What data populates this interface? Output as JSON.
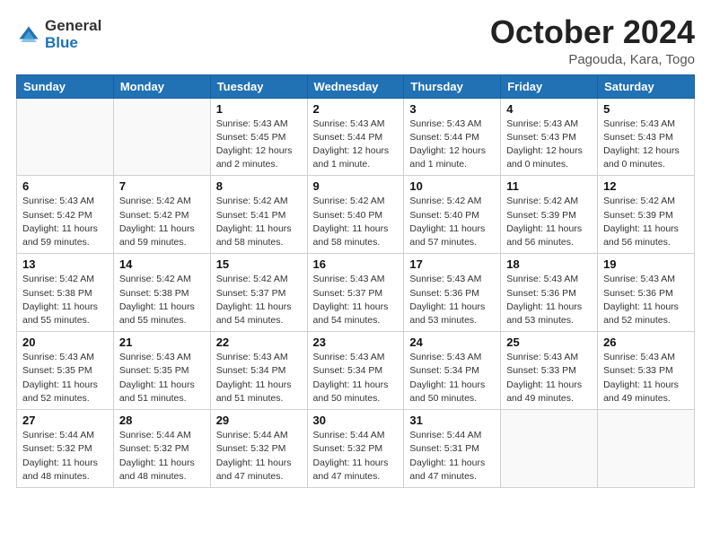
{
  "header": {
    "logo": {
      "general": "General",
      "blue": "Blue"
    },
    "title": "October 2024",
    "subtitle": "Pagouda, Kara, Togo"
  },
  "days": [
    "Sunday",
    "Monday",
    "Tuesday",
    "Wednesday",
    "Thursday",
    "Friday",
    "Saturday"
  ],
  "weeks": [
    [
      {
        "day": "",
        "info": ""
      },
      {
        "day": "",
        "info": ""
      },
      {
        "day": "1",
        "info": "Sunrise: 5:43 AM\nSunset: 5:45 PM\nDaylight: 12 hours and 2 minutes."
      },
      {
        "day": "2",
        "info": "Sunrise: 5:43 AM\nSunset: 5:44 PM\nDaylight: 12 hours and 1 minute."
      },
      {
        "day": "3",
        "info": "Sunrise: 5:43 AM\nSunset: 5:44 PM\nDaylight: 12 hours and 1 minute."
      },
      {
        "day": "4",
        "info": "Sunrise: 5:43 AM\nSunset: 5:43 PM\nDaylight: 12 hours and 0 minutes."
      },
      {
        "day": "5",
        "info": "Sunrise: 5:43 AM\nSunset: 5:43 PM\nDaylight: 12 hours and 0 minutes."
      }
    ],
    [
      {
        "day": "6",
        "info": "Sunrise: 5:43 AM\nSunset: 5:42 PM\nDaylight: 11 hours and 59 minutes."
      },
      {
        "day": "7",
        "info": "Sunrise: 5:42 AM\nSunset: 5:42 PM\nDaylight: 11 hours and 59 minutes."
      },
      {
        "day": "8",
        "info": "Sunrise: 5:42 AM\nSunset: 5:41 PM\nDaylight: 11 hours and 58 minutes."
      },
      {
        "day": "9",
        "info": "Sunrise: 5:42 AM\nSunset: 5:40 PM\nDaylight: 11 hours and 58 minutes."
      },
      {
        "day": "10",
        "info": "Sunrise: 5:42 AM\nSunset: 5:40 PM\nDaylight: 11 hours and 57 minutes."
      },
      {
        "day": "11",
        "info": "Sunrise: 5:42 AM\nSunset: 5:39 PM\nDaylight: 11 hours and 56 minutes."
      },
      {
        "day": "12",
        "info": "Sunrise: 5:42 AM\nSunset: 5:39 PM\nDaylight: 11 hours and 56 minutes."
      }
    ],
    [
      {
        "day": "13",
        "info": "Sunrise: 5:42 AM\nSunset: 5:38 PM\nDaylight: 11 hours and 55 minutes."
      },
      {
        "day": "14",
        "info": "Sunrise: 5:42 AM\nSunset: 5:38 PM\nDaylight: 11 hours and 55 minutes."
      },
      {
        "day": "15",
        "info": "Sunrise: 5:42 AM\nSunset: 5:37 PM\nDaylight: 11 hours and 54 minutes."
      },
      {
        "day": "16",
        "info": "Sunrise: 5:43 AM\nSunset: 5:37 PM\nDaylight: 11 hours and 54 minutes."
      },
      {
        "day": "17",
        "info": "Sunrise: 5:43 AM\nSunset: 5:36 PM\nDaylight: 11 hours and 53 minutes."
      },
      {
        "day": "18",
        "info": "Sunrise: 5:43 AM\nSunset: 5:36 PM\nDaylight: 11 hours and 53 minutes."
      },
      {
        "day": "19",
        "info": "Sunrise: 5:43 AM\nSunset: 5:36 PM\nDaylight: 11 hours and 52 minutes."
      }
    ],
    [
      {
        "day": "20",
        "info": "Sunrise: 5:43 AM\nSunset: 5:35 PM\nDaylight: 11 hours and 52 minutes."
      },
      {
        "day": "21",
        "info": "Sunrise: 5:43 AM\nSunset: 5:35 PM\nDaylight: 11 hours and 51 minutes."
      },
      {
        "day": "22",
        "info": "Sunrise: 5:43 AM\nSunset: 5:34 PM\nDaylight: 11 hours and 51 minutes."
      },
      {
        "day": "23",
        "info": "Sunrise: 5:43 AM\nSunset: 5:34 PM\nDaylight: 11 hours and 50 minutes."
      },
      {
        "day": "24",
        "info": "Sunrise: 5:43 AM\nSunset: 5:34 PM\nDaylight: 11 hours and 50 minutes."
      },
      {
        "day": "25",
        "info": "Sunrise: 5:43 AM\nSunset: 5:33 PM\nDaylight: 11 hours and 49 minutes."
      },
      {
        "day": "26",
        "info": "Sunrise: 5:43 AM\nSunset: 5:33 PM\nDaylight: 11 hours and 49 minutes."
      }
    ],
    [
      {
        "day": "27",
        "info": "Sunrise: 5:44 AM\nSunset: 5:32 PM\nDaylight: 11 hours and 48 minutes."
      },
      {
        "day": "28",
        "info": "Sunrise: 5:44 AM\nSunset: 5:32 PM\nDaylight: 11 hours and 48 minutes."
      },
      {
        "day": "29",
        "info": "Sunrise: 5:44 AM\nSunset: 5:32 PM\nDaylight: 11 hours and 47 minutes."
      },
      {
        "day": "30",
        "info": "Sunrise: 5:44 AM\nSunset: 5:32 PM\nDaylight: 11 hours and 47 minutes."
      },
      {
        "day": "31",
        "info": "Sunrise: 5:44 AM\nSunset: 5:31 PM\nDaylight: 11 hours and 47 minutes."
      },
      {
        "day": "",
        "info": ""
      },
      {
        "day": "",
        "info": ""
      }
    ]
  ]
}
